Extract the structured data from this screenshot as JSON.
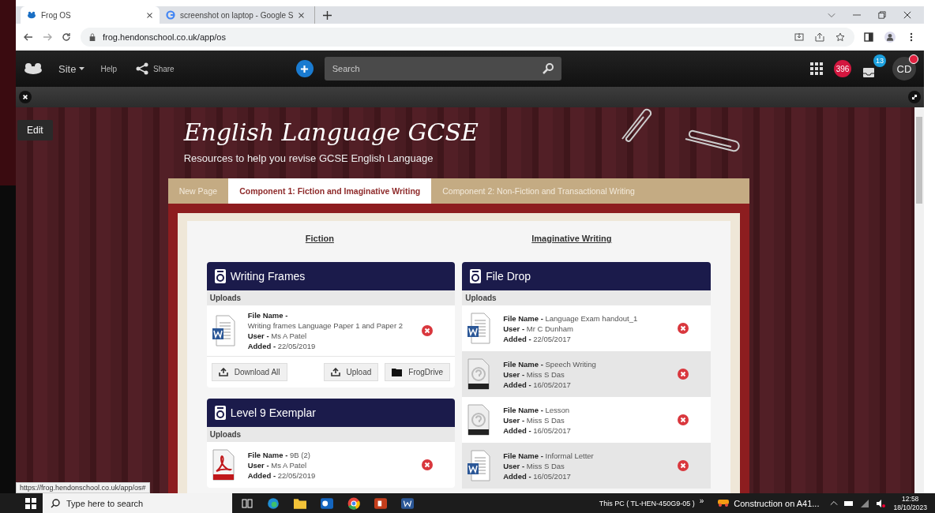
{
  "browser": {
    "tabs": [
      {
        "title": "Frog OS",
        "selected": true
      },
      {
        "title": "screenshot on laptop - Google S",
        "selected": false
      }
    ],
    "url": "frog.hendonschool.co.uk/app/os"
  },
  "toolbar": {
    "site_menu": "Site",
    "help": "Help",
    "share": "Share",
    "search": {
      "placeholder": "Search"
    },
    "notifications_badge": "396",
    "inbox_badge": "13",
    "avatar": "CD"
  },
  "edit_button": "Edit",
  "page": {
    "title": "English Language GCSE",
    "subtitle": "Resources to help you revise GCSE English Language",
    "tabs": [
      {
        "label": "New Page",
        "selected": false
      },
      {
        "label": "Component 1: Fiction and Imaginative Writing",
        "selected": true
      },
      {
        "label": "Component 2: Non-Fiction and Transactional Writing",
        "selected": false
      }
    ],
    "column_links": [
      "Fiction",
      "Imaginative Writing"
    ],
    "columns": [
      [
        {
          "title": "Writing Frames",
          "section": "Uploads",
          "files": [
            {
              "kind": "word",
              "lines": [
                "**File Name -**",
                "Writing frames Language Paper 1 and Paper 2",
                "**User -** Ms A Patel",
                "**Added -** 22/05/2019"
              ]
            }
          ],
          "buttons": [
            {
              "kind": "download",
              "label": "Download All"
            },
            {
              "kind": "upload",
              "label": "Upload"
            },
            {
              "kind": "folder",
              "label": "FrogDrive"
            }
          ]
        },
        {
          "title": "Level 9 Exemplar",
          "section": "Uploads",
          "files": [
            {
              "kind": "pdf",
              "lines": [
                "**File Name -** 9B (2)",
                "**User -** Ms A Patel",
                "**Added -** 22/05/2019"
              ]
            }
          ]
        }
      ],
      [
        {
          "title": "File Drop",
          "section": "Uploads",
          "files": [
            {
              "kind": "word",
              "lines": [
                "**File Name -** Language Exam handout_1",
                "**User -** Mr C Dunham",
                "**Added -** 22/05/2017"
              ]
            },
            {
              "kind": "ppt",
              "lines": [
                "**File Name -** Speech Writing",
                "**User -** Miss S Das",
                "**Added -** 16/05/2017"
              ]
            },
            {
              "kind": "ppt",
              "lines": [
                "**File Name -** Lesson",
                "**User -** Miss S Das",
                "**Added -** 16/05/2017"
              ]
            },
            {
              "kind": "word",
              "lines": [
                "**File Name -** Informal Letter",
                "**User -** Miss S Das",
                "**Added -** 16/05/2017"
              ]
            }
          ]
        }
      ]
    ]
  },
  "status_url": "https://frog.hendonschool.co.uk/app/os#",
  "taskbar": {
    "search": {
      "placeholder": "Type here to search"
    },
    "device": "This PC ( TL-HEN-450G9-05 )",
    "chevron": "»",
    "notification": "Construction on A41...",
    "time": "12:58",
    "date": "18/10/2023"
  }
}
